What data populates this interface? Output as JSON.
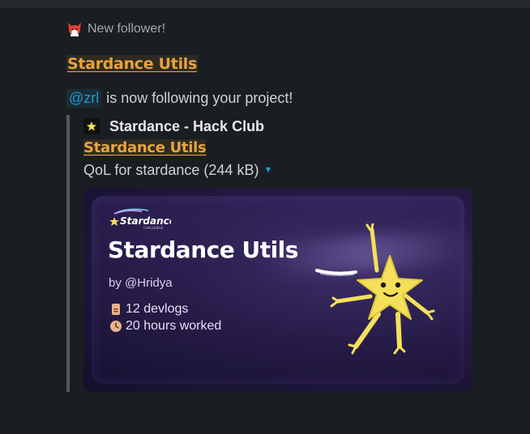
{
  "message": {
    "context_text": "New follower!",
    "project_title": "Stardance Utils",
    "mention": "@zrl",
    "follow_text": "is now following your project!"
  },
  "attachment": {
    "app_name": "Stardance - Hack Club",
    "link_title": "Stardance Utils",
    "description": "QoL for stardance (244 kB)",
    "card": {
      "title": "Stardance Utils",
      "author": "by @Hridya",
      "devlogs": "12 devlogs",
      "hours": "20 hours worked",
      "logo_text": "Stardance"
    }
  },
  "colors": {
    "background": "#1a1d21",
    "link": "#e8a33c",
    "mention": "#1d9bd1",
    "card_bg": "#241a44",
    "star": "#f5e05a"
  },
  "icons": [
    "fox-emoji-icon",
    "app-icon",
    "caret-down-icon",
    "document-icon",
    "clock-icon"
  ]
}
